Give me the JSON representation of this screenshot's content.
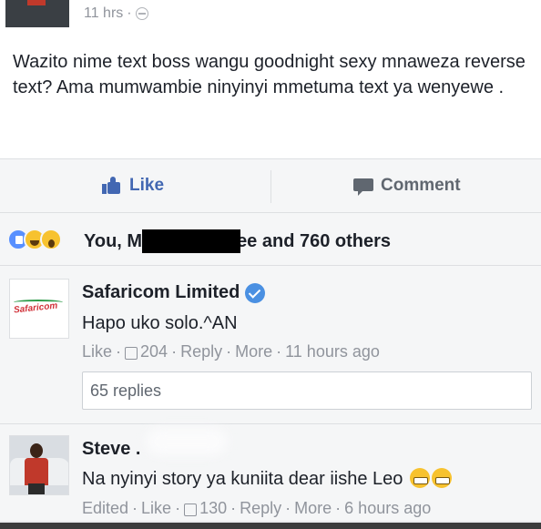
{
  "post": {
    "timestamp": "11 hrs",
    "separator": "·",
    "privacy_icon": "globe-icon",
    "text": "Wazito nime text boss wangu goodnight sexy mnaweza reverse text? Ama mumwambie ninyinyi mmetuma text ya wenyewe ."
  },
  "actions": {
    "like_label": "Like",
    "comment_label": "Comment",
    "like_color": "#4267b2",
    "comment_color": "#606770"
  },
  "reactions": {
    "icons": [
      "like-reaction-icon",
      "haha-reaction-icon",
      "wow-reaction-icon"
    ],
    "text_start": "You, M",
    "text_end": "ee and 760 others"
  },
  "comments": [
    {
      "name": "Safaricom Limited",
      "verified": true,
      "avatar_logo_text": "Safaricom",
      "text": "Hapo uko solo.^AN",
      "actions": {
        "like": "Like",
        "like_count": "204",
        "reply": "Reply",
        "more": "More",
        "time": "11 hours ago"
      },
      "replies_label": "65 replies"
    },
    {
      "name": "Steve .",
      "verified": false,
      "text": "Na nyinyi story ya kuniita dear iishe Leo",
      "emoji": [
        "grimacing-face-icon",
        "grimacing-face-icon"
      ],
      "actions": {
        "edited": "Edited",
        "like": "Like",
        "like_count": "130",
        "reply": "Reply",
        "more": "More",
        "time": "6 hours ago"
      }
    }
  ],
  "colors": {
    "facebook_blue": "#4267b2",
    "verified_blue": "#4a90e2",
    "meta_gray": "#90949c"
  }
}
